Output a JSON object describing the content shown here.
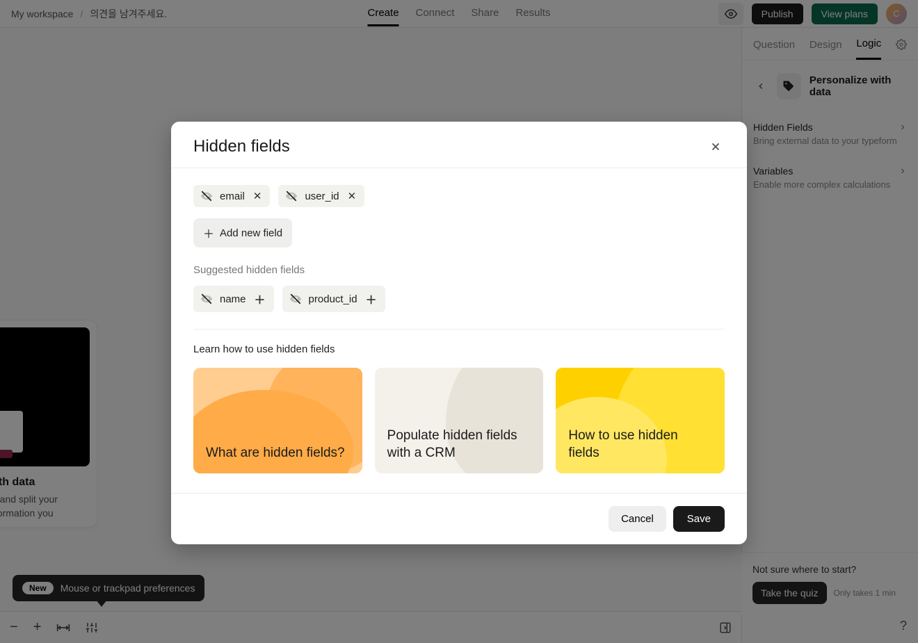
{
  "header": {
    "breadcrumb_workspace": "My workspace",
    "breadcrumb_sep": "/",
    "breadcrumb_title": "의견을 남겨주세요.",
    "nav": {
      "create": "Create",
      "connect": "Connect",
      "share": "Share",
      "results": "Results"
    },
    "publish": "Publish",
    "view_plans": "View plans",
    "avatar_initial": "C"
  },
  "right_panel": {
    "tabs": {
      "question": "Question",
      "design": "Design",
      "logic": "Logic"
    },
    "section_title": "Personalize with data",
    "hidden_fields": {
      "title": "Hidden Fields",
      "desc": "Bring external data to your typeform"
    },
    "variables": {
      "title": "Variables",
      "desc": "Enable more complex calculations"
    }
  },
  "quiz": {
    "prompt": "Not sure where to start?",
    "button": "Take the quiz",
    "note": "Only takes 1 min"
  },
  "bg_card": {
    "title": "with data",
    "desc": "ns and split your information you"
  },
  "notif": {
    "badge": "New",
    "text": "Mouse or trackpad preferences"
  },
  "modal": {
    "title": "Hidden fields",
    "fields": [
      "email",
      "user_id"
    ],
    "add_label": "Add new field",
    "suggested_label": "Suggested hidden fields",
    "suggested": [
      "name",
      "product_id"
    ],
    "learn_label": "Learn how to use hidden fields",
    "learn_cards": [
      "What are hidden fields?",
      "Populate hidden fields with a CRM",
      "How to use hidden fields"
    ],
    "cancel": "Cancel",
    "save": "Save"
  }
}
